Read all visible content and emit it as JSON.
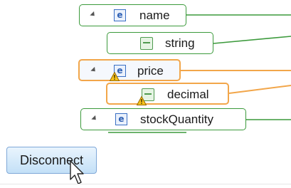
{
  "tree": {
    "items": [
      {
        "kind": "element",
        "label": "name",
        "warning": false
      },
      {
        "kind": "type",
        "label": "string",
        "warning": false
      },
      {
        "kind": "element",
        "label": "price",
        "warning": true
      },
      {
        "kind": "type",
        "label": "decimal",
        "warning": true
      },
      {
        "kind": "element",
        "label": "stockQuantity",
        "warning": false
      }
    ]
  },
  "button": {
    "label": "Disconnect"
  },
  "icons": {
    "element": "e",
    "type": "simple-type-icon",
    "expander": "expand-triangle-icon",
    "warning": "warning-icon",
    "cursor": "pointer-cursor"
  },
  "colors": {
    "connected": "#3c9a3c",
    "warning": "#f2a64a",
    "button_border": "#7fa8d8"
  }
}
